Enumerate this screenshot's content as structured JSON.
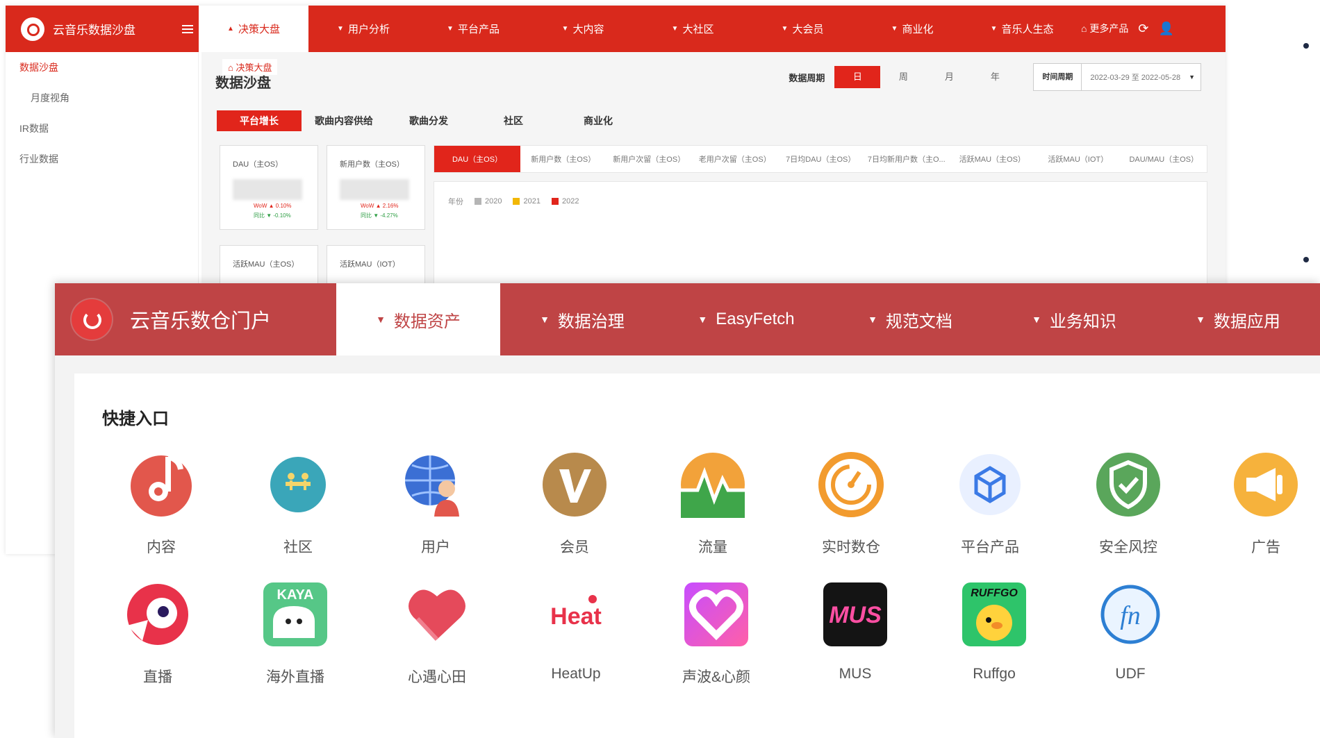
{
  "back_window": {
    "brand": "云音乐数据沙盘",
    "nav": [
      {
        "label": "决策大盘",
        "caret": "▲",
        "active": true
      },
      {
        "label": "用户分析",
        "caret": "▼"
      },
      {
        "label": "平台产品",
        "caret": "▼"
      },
      {
        "label": "大内容",
        "caret": "▼"
      },
      {
        "label": "大社区",
        "caret": "▼"
      },
      {
        "label": "大会员",
        "caret": "▼"
      },
      {
        "label": "商业化",
        "caret": "▼"
      },
      {
        "label": "音乐人生态",
        "caret": "▼"
      }
    ],
    "more_products": "更多产品",
    "sidebar": [
      "数据沙盘",
      "月度视角",
      "IR数据",
      "行业数据"
    ],
    "breadcrumb": "决策大盘",
    "page_title": "数据沙盘",
    "period": {
      "label": "数据周期",
      "options": [
        "日",
        "周",
        "月",
        "年"
      ],
      "active": "日",
      "time_label": "时间周期",
      "range": "2022-03-29 至 2022-05-28"
    },
    "subtabs": [
      "平台增长",
      "歌曲内容供给",
      "歌曲分发",
      "社区",
      "商业化"
    ],
    "cards": [
      {
        "title": "DAU（主OS）",
        "line1": "WoW ▲ 0.10%",
        "line2": "同比 ▼ -0.10%"
      },
      {
        "title": "新用户数（主OS）",
        "line1": "WoW ▲ 2.16%",
        "line2": "同比 ▼ -4.27%"
      },
      {
        "title": "活跃MAU（主OS）"
      },
      {
        "title": "活跃MAU（IOT）"
      }
    ],
    "metrics": [
      "DAU（主OS）",
      "新用户数（主OS）",
      "新用户次留（主OS）",
      "老用户次留（主OS）",
      "7日均DAU（主OS）",
      "7日均新用户数（主O...",
      "活跃MAU（主OS）",
      "活跃MAU（IOT）",
      "DAU/MAU（主OS）"
    ],
    "legend": {
      "prefix": "年份",
      "items": [
        {
          "name": "2020",
          "color": "#b5b5b5"
        },
        {
          "name": "2021",
          "color": "#f2b705"
        },
        {
          "name": "2022",
          "color": "#e1251b"
        }
      ]
    }
  },
  "front_window": {
    "brand": "云音乐数仓门户",
    "nav": [
      {
        "label": "数据资产",
        "active": true
      },
      {
        "label": "数据治理"
      },
      {
        "label": "EasyFetch"
      },
      {
        "label": "规范文档"
      },
      {
        "label": "业务知识"
      },
      {
        "label": "数据应用"
      }
    ],
    "section_title": "快捷入口",
    "row1": [
      {
        "label": "内容",
        "icon": "music-note-icon"
      },
      {
        "label": "社区",
        "icon": "community-icon"
      },
      {
        "label": "用户",
        "icon": "globe-user-icon"
      },
      {
        "label": "会员",
        "icon": "vip-icon"
      },
      {
        "label": "流量",
        "icon": "pulse-icon"
      },
      {
        "label": "实时数仓",
        "icon": "speedometer-icon"
      },
      {
        "label": "平台产品",
        "icon": "cube-icon"
      },
      {
        "label": "安全风控",
        "icon": "shield-icon"
      },
      {
        "label": "广告",
        "icon": "megaphone-icon"
      }
    ],
    "row2": [
      {
        "label": "直播",
        "icon": "live-icon"
      },
      {
        "label": "海外直播",
        "icon": "kaya-icon",
        "text": "KAYA"
      },
      {
        "label": "心遇心田",
        "icon": "heart-icon"
      },
      {
        "label": "HeatUp",
        "icon": "heatup-icon",
        "text": "Heat"
      },
      {
        "label": "声波&心颜",
        "icon": "sound-heart-icon"
      },
      {
        "label": "MUS",
        "icon": "mus-icon",
        "text": "MUS"
      },
      {
        "label": "Ruffgo",
        "icon": "ruffgo-icon",
        "text": "RUFFGO"
      },
      {
        "label": "UDF",
        "icon": "udf-icon",
        "text": "fn"
      }
    ]
  }
}
